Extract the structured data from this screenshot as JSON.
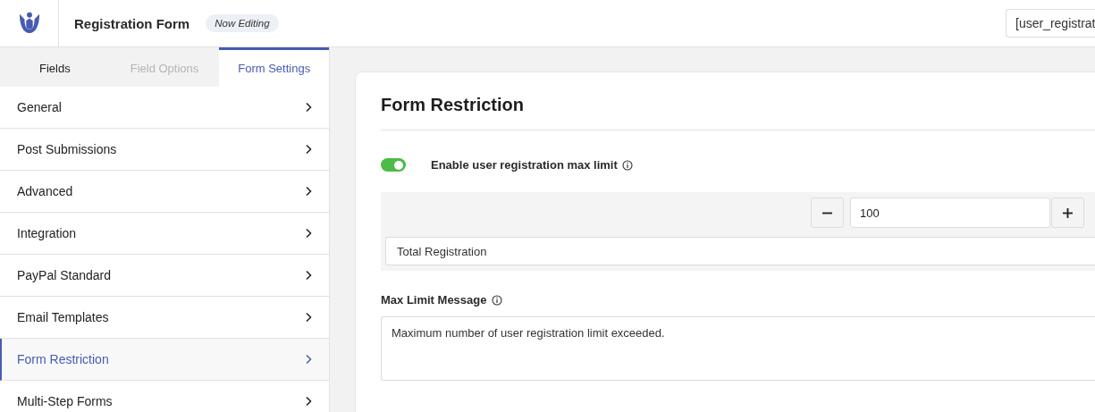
{
  "header": {
    "title": "Registration Form",
    "badge": "Now Editing",
    "shortcode": "[user_registrat"
  },
  "tabs": [
    {
      "label": "Fields",
      "selected": false,
      "disabled": false
    },
    {
      "label": "Field Options",
      "selected": false,
      "disabled": true
    },
    {
      "label": "Form Settings",
      "selected": true,
      "disabled": false
    }
  ],
  "sidebar": {
    "items": [
      {
        "label": "General",
        "selected": false
      },
      {
        "label": "Post Submissions",
        "selected": false
      },
      {
        "label": "Advanced",
        "selected": false
      },
      {
        "label": "Integration",
        "selected": false
      },
      {
        "label": "PayPal Standard",
        "selected": false
      },
      {
        "label": "Email Templates",
        "selected": false
      },
      {
        "label": "Form Restriction",
        "selected": true
      },
      {
        "label": "Multi-Step Forms",
        "selected": false
      }
    ]
  },
  "panel": {
    "title": "Form Restriction",
    "toggle": {
      "label": "Enable user registration max limit",
      "on": true
    },
    "limit": {
      "value": "100",
      "select": "Total Registration"
    },
    "message": {
      "label": "Max Limit Message",
      "value": "Maximum number of user registration limit exceeded."
    }
  }
}
